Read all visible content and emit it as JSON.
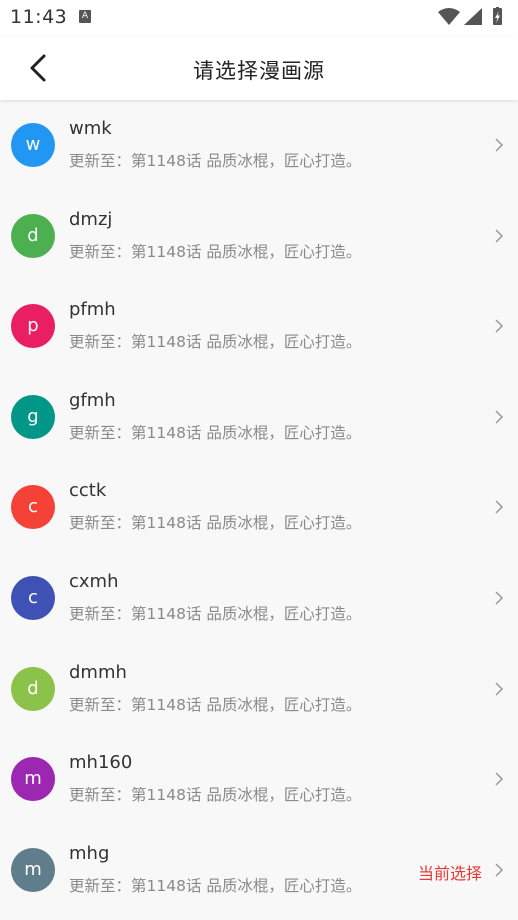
{
  "status_bar": {
    "time": "11:43",
    "notif_icon": "A"
  },
  "header": {
    "title": "请选择漫画源",
    "back_icon": "chevron-left-icon"
  },
  "items": [
    {
      "letter": "w",
      "name": "wmk",
      "subtitle": "更新至：第1148话 品质冰棍，匠心打造。",
      "color": "#2196f3",
      "current": ""
    },
    {
      "letter": "d",
      "name": "dmzj",
      "subtitle": "更新至：第1148话 品质冰棍，匠心打造。",
      "color": "#4caf50",
      "current": ""
    },
    {
      "letter": "p",
      "name": "pfmh",
      "subtitle": "更新至：第1148话 品质冰棍，匠心打造。",
      "color": "#e91e63",
      "current": ""
    },
    {
      "letter": "g",
      "name": "gfmh",
      "subtitle": "更新至：第1148话 品质冰棍，匠心打造。",
      "color": "#009688",
      "current": ""
    },
    {
      "letter": "c",
      "name": "cctk",
      "subtitle": "更新至：第1148话 品质冰棍，匠心打造。",
      "color": "#f44336",
      "current": ""
    },
    {
      "letter": "c",
      "name": "cxmh",
      "subtitle": "更新至：第1148话 品质冰棍，匠心打造。",
      "color": "#3f51b5",
      "current": ""
    },
    {
      "letter": "d",
      "name": "dmmh",
      "subtitle": "更新至：第1148话 品质冰棍，匠心打造。",
      "color": "#8bc34a",
      "current": ""
    },
    {
      "letter": "m",
      "name": "mh160",
      "subtitle": "更新至：第1148话 品质冰棍，匠心打造。",
      "color": "#9c27b0",
      "current": ""
    },
    {
      "letter": "m",
      "name": "mhg",
      "subtitle": "更新至：第1148话 品质冰棍，匠心打造。",
      "color": "#607d8b",
      "current": "当前选择"
    }
  ]
}
